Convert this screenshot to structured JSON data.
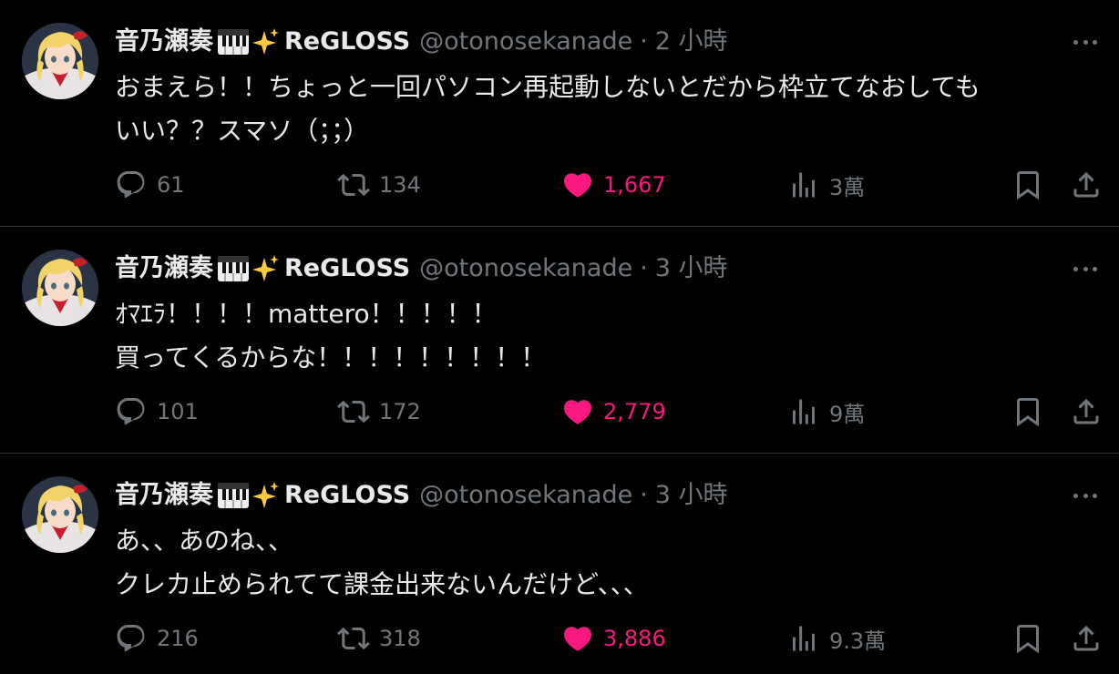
{
  "colors": {
    "background": "#000000",
    "text": "#e7e9ea",
    "muted": "#71767b",
    "like": "#f91880",
    "divider": "#2f3336"
  },
  "tweets": [
    {
      "display_name": "音乃瀬奏",
      "name_suffix": "ReGLOSS",
      "handle": "@otonosekanade",
      "separator": "·",
      "time": "2 小時",
      "text": "おまえら！！ちょっと一回パソコン再起動しないとだから枠立てなおしても\nいい？？スマソ（；；）",
      "replies": "61",
      "retweets": "134",
      "likes": "1,667",
      "views": "3萬",
      "liked": true
    },
    {
      "display_name": "音乃瀬奏",
      "name_suffix": "ReGLOSS",
      "handle": "@otonosekanade",
      "separator": "·",
      "time": "3 小時",
      "text": "ｵﾏｴﾗ！！！！mattero！！！！！\n買ってくるからな！！！！！！！！！",
      "replies": "101",
      "retweets": "172",
      "likes": "2,779",
      "views": "9萬",
      "liked": true
    },
    {
      "display_name": "音乃瀬奏",
      "name_suffix": "ReGLOSS",
      "handle": "@otonosekanade",
      "separator": "·",
      "time": "3 小時",
      "text": "あ、、あのね、、\nクレカ止められてて課金出来ないんだけど、、、",
      "replies": "216",
      "retweets": "318",
      "likes": "3,886",
      "views": "9.3萬",
      "liked": true
    }
  ],
  "icons": {
    "name_emojis": [
      "piano-icon",
      "sparkle-icon"
    ],
    "actions": [
      "reply-icon",
      "retweet-icon",
      "heart-icon",
      "views-icon",
      "bookmark-icon",
      "share-icon"
    ],
    "more": "more-icon"
  }
}
